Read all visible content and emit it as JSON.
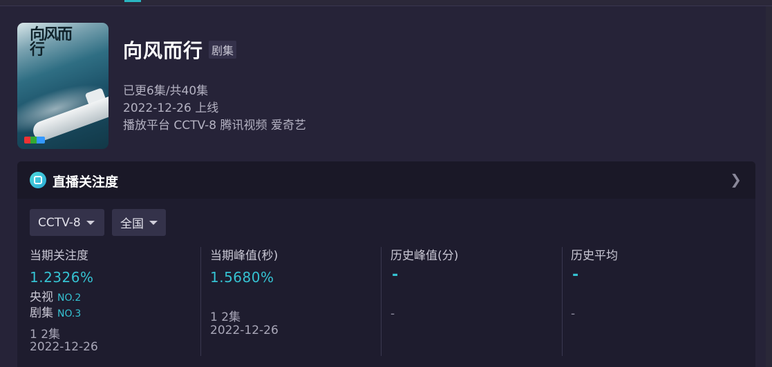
{
  "show": {
    "title": "向风而行",
    "type": "剧集",
    "episodes": "已更6集/共40集",
    "release": "2022-12-26 上线",
    "platforms": "播放平台 CCTV-8 腾讯视频 爱奇艺",
    "poster_title": "向风而行"
  },
  "panel": {
    "title": "直播关注度",
    "chevron": "❯"
  },
  "filters": {
    "channel": "CCTV-8",
    "region": "全国"
  },
  "stats": [
    {
      "label": "当期关注度",
      "value": "1.2326%",
      "rank1_label": "央视",
      "rank1_value": "NO.2",
      "rank2_label": "剧集",
      "rank2_value": "NO.3",
      "episode": "1 2集",
      "date": "2022-12-26"
    },
    {
      "label": "当期峰值(秒)",
      "value": "1.5680%",
      "episode": "1 2集",
      "date": "2022-12-26"
    },
    {
      "label": "历史峰值(分)",
      "value": "-",
      "sub": "-"
    },
    {
      "label": "历史平均",
      "value": "-",
      "sub": "-"
    }
  ],
  "colors": {
    "accent": "#35c2d2",
    "background": "#262338",
    "panel": "#1e1c2e"
  }
}
